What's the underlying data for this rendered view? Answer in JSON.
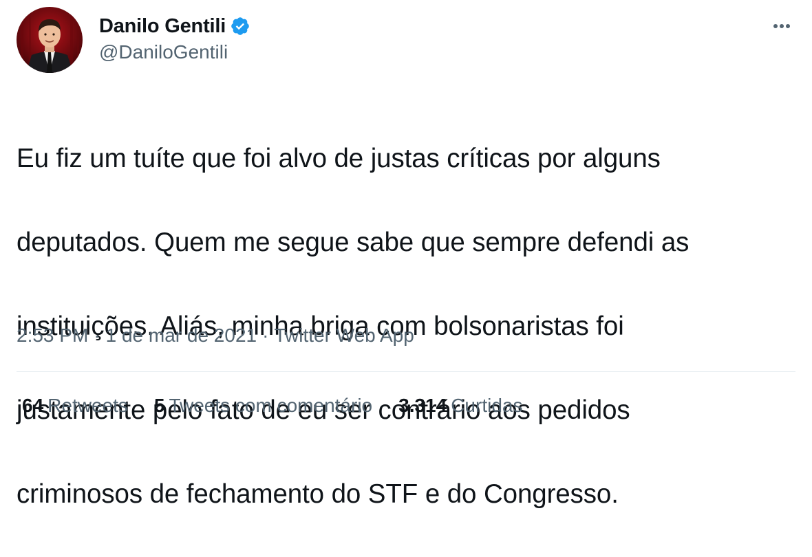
{
  "author": {
    "display_name": "Danilo Gentili",
    "handle": "@DaniloGentili",
    "verified": true,
    "avatar_icon": "avatar-photo"
  },
  "tweet": {
    "text_lines": [
      "Eu fiz um tuíte que foi alvo de justas críticas por alguns",
      "deputados. Quem me segue sabe que sempre defendi as",
      "instituições. Aliás, minha briga com bolsonaristas foi",
      "justamente pelo fato de eu ser contrário aos pedidos",
      "criminosos de fechamento do STF e do Congresso."
    ]
  },
  "meta": {
    "time": "2:53 PM",
    "separator": "·",
    "date": "1 de mar de 2021",
    "source": "Twitter Web App"
  },
  "stats": {
    "retweets_count": "64",
    "retweets_label": "Retweets",
    "quotes_count": "5",
    "quotes_label": "Tweets com comentário",
    "likes_count": "3.314",
    "likes_label": "Curtidas"
  },
  "colors": {
    "text_primary": "#0f1419",
    "text_secondary": "#536471",
    "verified_blue": "#1d9bf0",
    "divider": "#e6ecf0"
  },
  "icons": {
    "verified": "verified-badge-icon",
    "more": "more-horizontal-icon"
  }
}
